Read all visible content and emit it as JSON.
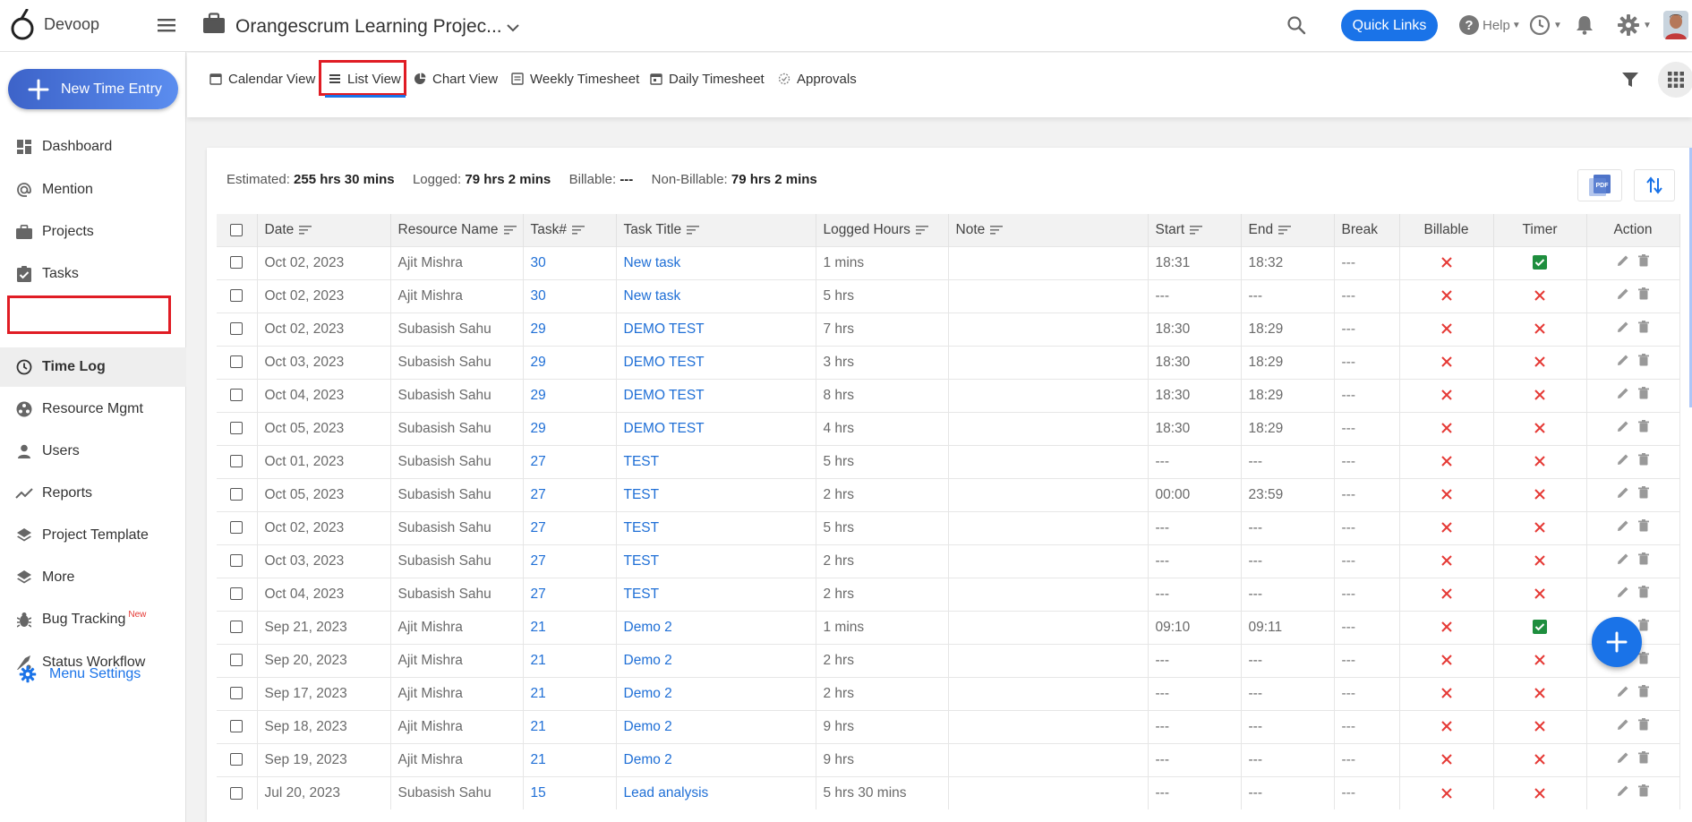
{
  "brand": {
    "name": "Devoop"
  },
  "header": {
    "project_title": "Orangescrum Learning Projec...",
    "quick_links_label": "Quick Links",
    "help_label": "Help"
  },
  "sidebar": {
    "new_entry_label": "New Time Entry",
    "items": [
      {
        "label": "Dashboard",
        "icon": "dashboard-icon"
      },
      {
        "label": "Mention",
        "icon": "at-icon"
      },
      {
        "label": "Projects",
        "icon": "briefcase-icon"
      },
      {
        "label": "Tasks",
        "icon": "clipboard-check-icon"
      },
      {
        "label": "Time Log",
        "icon": "clock-icon",
        "active": true
      },
      {
        "label": "Resource Mgmt",
        "icon": "resource-icon"
      },
      {
        "label": "Users",
        "icon": "user-icon"
      },
      {
        "label": "Reports",
        "icon": "trend-icon"
      },
      {
        "label": "Project Template",
        "icon": "layers-icon"
      },
      {
        "label": "More",
        "icon": "layers-icon"
      },
      {
        "label": "Bug Tracking",
        "icon": "bug-icon",
        "badge": "New"
      },
      {
        "label": "Status Workflow",
        "icon": "workflow-icon"
      }
    ],
    "menu_settings_label": "Menu Settings"
  },
  "tabs": [
    {
      "label": "Calendar View",
      "icon": "calendar-icon"
    },
    {
      "label": "List View",
      "icon": "list-icon",
      "active": true
    },
    {
      "label": "Chart View",
      "icon": "pie-chart-icon"
    },
    {
      "label": "Weekly Timesheet",
      "icon": "timesheet-icon"
    },
    {
      "label": "Daily Timesheet",
      "icon": "calendar-day-icon"
    },
    {
      "label": "Approvals",
      "icon": "approval-icon"
    }
  ],
  "summary": {
    "estimated_label": "Estimated:",
    "estimated_value": "255 hrs 30 mins",
    "logged_label": "Logged:",
    "logged_value": "79 hrs 2 mins",
    "billable_label": "Billable:",
    "billable_value": "---",
    "nonbillable_label": "Non-Billable:",
    "nonbillable_value": "79 hrs 2 mins"
  },
  "table": {
    "columns": [
      "Date",
      "Resource Name",
      "Task#",
      "Task Title",
      "Logged Hours",
      "Note",
      "Start",
      "End",
      "Break",
      "Billable",
      "Timer",
      "Action"
    ],
    "rows": [
      {
        "date": "Oct 02, 2023",
        "resource": "Ajit Mishra",
        "task_no": "30",
        "title": "New task",
        "hours": "1 mins",
        "note": "",
        "start": "18:31",
        "end": "18:32",
        "brk": "---",
        "billable": false,
        "timer": true
      },
      {
        "date": "Oct 02, 2023",
        "resource": "Ajit Mishra",
        "task_no": "30",
        "title": "New task",
        "hours": "5 hrs",
        "note": "",
        "start": "---",
        "end": "---",
        "brk": "---",
        "billable": false,
        "timer": false
      },
      {
        "date": "Oct 02, 2023",
        "resource": "Subasish Sahu",
        "task_no": "29",
        "title": "DEMO TEST",
        "hours": "7 hrs",
        "note": "",
        "start": "18:30",
        "end": "18:29",
        "brk": "---",
        "billable": false,
        "timer": false
      },
      {
        "date": "Oct 03, 2023",
        "resource": "Subasish Sahu",
        "task_no": "29",
        "title": "DEMO TEST",
        "hours": "3 hrs",
        "note": "",
        "start": "18:30",
        "end": "18:29",
        "brk": "---",
        "billable": false,
        "timer": false
      },
      {
        "date": "Oct 04, 2023",
        "resource": "Subasish Sahu",
        "task_no": "29",
        "title": "DEMO TEST",
        "hours": "8 hrs",
        "note": "",
        "start": "18:30",
        "end": "18:29",
        "brk": "---",
        "billable": false,
        "timer": false
      },
      {
        "date": "Oct 05, 2023",
        "resource": "Subasish Sahu",
        "task_no": "29",
        "title": "DEMO TEST",
        "hours": "4 hrs",
        "note": "",
        "start": "18:30",
        "end": "18:29",
        "brk": "---",
        "billable": false,
        "timer": false
      },
      {
        "date": "Oct 01, 2023",
        "resource": "Subasish Sahu",
        "task_no": "27",
        "title": "TEST",
        "hours": "5 hrs",
        "note": "",
        "start": "---",
        "end": "---",
        "brk": "---",
        "billable": false,
        "timer": false
      },
      {
        "date": "Oct 05, 2023",
        "resource": "Subasish Sahu",
        "task_no": "27",
        "title": "TEST",
        "hours": "2 hrs",
        "note": "",
        "start": "00:00",
        "end": "23:59",
        "brk": "---",
        "billable": false,
        "timer": false
      },
      {
        "date": "Oct 02, 2023",
        "resource": "Subasish Sahu",
        "task_no": "27",
        "title": "TEST",
        "hours": "5 hrs",
        "note": "",
        "start": "---",
        "end": "---",
        "brk": "---",
        "billable": false,
        "timer": false
      },
      {
        "date": "Oct 03, 2023",
        "resource": "Subasish Sahu",
        "task_no": "27",
        "title": "TEST",
        "hours": "2 hrs",
        "note": "",
        "start": "---",
        "end": "---",
        "brk": "---",
        "billable": false,
        "timer": false
      },
      {
        "date": "Oct 04, 2023",
        "resource": "Subasish Sahu",
        "task_no": "27",
        "title": "TEST",
        "hours": "2 hrs",
        "note": "",
        "start": "---",
        "end": "---",
        "brk": "---",
        "billable": false,
        "timer": false
      },
      {
        "date": "Sep 21, 2023",
        "resource": "Ajit Mishra",
        "task_no": "21",
        "title": "Demo 2",
        "hours": "1 mins",
        "note": "",
        "start": "09:10",
        "end": "09:11",
        "brk": "---",
        "billable": false,
        "timer": true
      },
      {
        "date": "Sep 20, 2023",
        "resource": "Ajit Mishra",
        "task_no": "21",
        "title": "Demo 2",
        "hours": "2 hrs",
        "note": "",
        "start": "---",
        "end": "---",
        "brk": "---",
        "billable": false,
        "timer": false
      },
      {
        "date": "Sep 17, 2023",
        "resource": "Ajit Mishra",
        "task_no": "21",
        "title": "Demo 2",
        "hours": "2 hrs",
        "note": "",
        "start": "---",
        "end": "---",
        "brk": "---",
        "billable": false,
        "timer": false
      },
      {
        "date": "Sep 18, 2023",
        "resource": "Ajit Mishra",
        "task_no": "21",
        "title": "Demo 2",
        "hours": "9 hrs",
        "note": "",
        "start": "---",
        "end": "---",
        "brk": "---",
        "billable": false,
        "timer": false
      },
      {
        "date": "Sep 19, 2023",
        "resource": "Ajit Mishra",
        "task_no": "21",
        "title": "Demo 2",
        "hours": "9 hrs",
        "note": "",
        "start": "---",
        "end": "---",
        "brk": "---",
        "billable": false,
        "timer": false
      },
      {
        "date": "Jul 20, 2023",
        "resource": "Subasish Sahu",
        "task_no": "15",
        "title": "Lead analysis",
        "hours": "5 hrs 30 mins",
        "note": "",
        "start": "---",
        "end": "---",
        "brk": "---",
        "billable": false,
        "timer": false
      }
    ]
  },
  "colors": {
    "primary": "#1a73e8",
    "highlight_red": "#e01c24",
    "cross_red": "#e53935",
    "check_green": "#1e8e3e"
  }
}
